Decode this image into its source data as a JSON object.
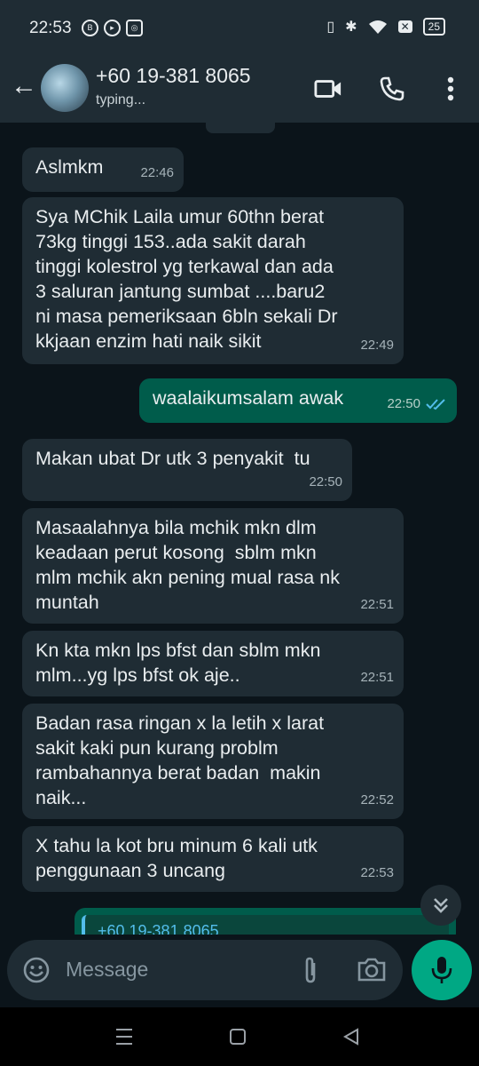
{
  "status_bar": {
    "time": "22:53",
    "battery": "25"
  },
  "header": {
    "contact": "+60 19-381 8065",
    "status": "typing..."
  },
  "messages": [
    {
      "direction": "in",
      "text": "Aslmkm",
      "time": "22:46"
    },
    {
      "direction": "in",
      "text": "Sya MChik Laila umur 60thn berat\n73kg tinggi 153..ada sakit darah\ntinggi kolestrol yg terkawal dan ada\n3 saluran jantung sumbat ....baru2\nni masa pemeriksaan 6bln sekali Dr\nkkjaan enzim hati naik sikit",
      "time": "22:49"
    },
    {
      "direction": "out",
      "text": "waalaikumsalam awak",
      "time": "22:50",
      "read": true
    },
    {
      "direction": "in",
      "text": "Makan ubat Dr utk 3 penyakit  tu",
      "time": "22:50"
    },
    {
      "direction": "in",
      "text": "Masaalahnya bila mchik mkn dlm\nkeadaan perut kosong  sblm mkn\nmlm mchik akn pening mual rasa nk\nmuntah",
      "time": "22:51"
    },
    {
      "direction": "in",
      "text": "Kn kta mkn lps bfst dan sblm mkn\nmlm...yg lps bfst ok aje..",
      "time": "22:51"
    },
    {
      "direction": "in",
      "text": "Badan rasa ringan x la letih x larat\nsakit kaki pun kurang problm\nrambahannya berat badan  makin\nnaik...",
      "time": "22:52"
    },
    {
      "direction": "in",
      "text": "X tahu la kot bru minum 6 kali utk\npenggunaan 3 uncang",
      "time": "22:53"
    }
  ],
  "quoted_preview": "+60 19-381 8065",
  "input": {
    "placeholder": "Message"
  },
  "colors": {
    "background": "#0b141a",
    "incoming_bubble": "#1f2c34",
    "outgoing_bubble": "#005c4b",
    "accent": "#00a884",
    "read_tick": "#53bdeb"
  }
}
